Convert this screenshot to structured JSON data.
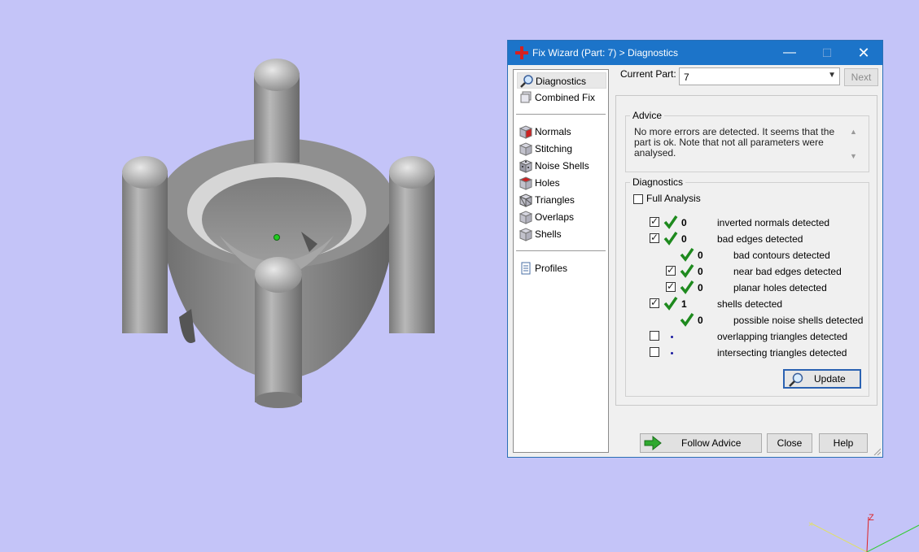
{
  "dialog": {
    "title": "Fix Wizard (Part: 7) > Diagnostics",
    "current_part_label": "Current Part:",
    "current_part_value": "7",
    "next_label": "Next"
  },
  "sidebar": {
    "items": [
      {
        "label": "Diagnostics",
        "icon": "magnifier-icon",
        "selected": true
      },
      {
        "label": "Combined Fix",
        "icon": "cube-stack-icon"
      },
      {
        "label": "Normals",
        "icon": "cube-red-face-icon"
      },
      {
        "label": "Stitching",
        "icon": "cube-stitch-icon"
      },
      {
        "label": "Noise Shells",
        "icon": "noise-shells-icon"
      },
      {
        "label": "Holes",
        "icon": "cube-hole-icon"
      },
      {
        "label": "Triangles",
        "icon": "triangles-icon"
      },
      {
        "label": "Overlaps",
        "icon": "overlaps-icon"
      },
      {
        "label": "Shells",
        "icon": "shells-icon"
      },
      {
        "label": "Profiles",
        "icon": "document-icon"
      }
    ]
  },
  "advice": {
    "title": "Advice",
    "text": "No more errors are detected. It seems that the part is ok. Note that not all parameters were analysed."
  },
  "diagnostics": {
    "title": "Diagnostics",
    "full_analysis_label": "Full Analysis",
    "rows": [
      {
        "checked": true,
        "status": "ok",
        "count": "0",
        "label": "inverted normals detected"
      },
      {
        "checked": true,
        "status": "ok",
        "count": "0",
        "label": "bad edges detected"
      },
      {
        "checked": null,
        "status": "ok",
        "count": "0",
        "label": "bad contours detected"
      },
      {
        "checked": true,
        "status": "ok",
        "count": "0",
        "label": "near bad edges detected"
      },
      {
        "checked": true,
        "status": "ok",
        "count": "0",
        "label": "planar holes detected"
      },
      {
        "checked": true,
        "status": "ok",
        "count": "1",
        "label": "shells detected"
      },
      {
        "checked": null,
        "status": "ok",
        "count": "0",
        "label": "possible noise shells detected"
      },
      {
        "checked": false,
        "status": "not-run",
        "count": "",
        "label": "overlapping triangles detected"
      },
      {
        "checked": false,
        "status": "not-run",
        "count": "",
        "label": "intersecting triangles detected"
      }
    ],
    "update_label": "Update"
  },
  "footer": {
    "follow_advice_label": "Follow Advice",
    "close_label": "Close",
    "help_label": "Help"
  },
  "viewport": {
    "background": "#c4c4f8",
    "axis_z_label": "Z"
  },
  "colors": {
    "titlebar": "#1c74c9",
    "ok_tick": "#1e8a1e",
    "arrow": "#2fa82f"
  }
}
